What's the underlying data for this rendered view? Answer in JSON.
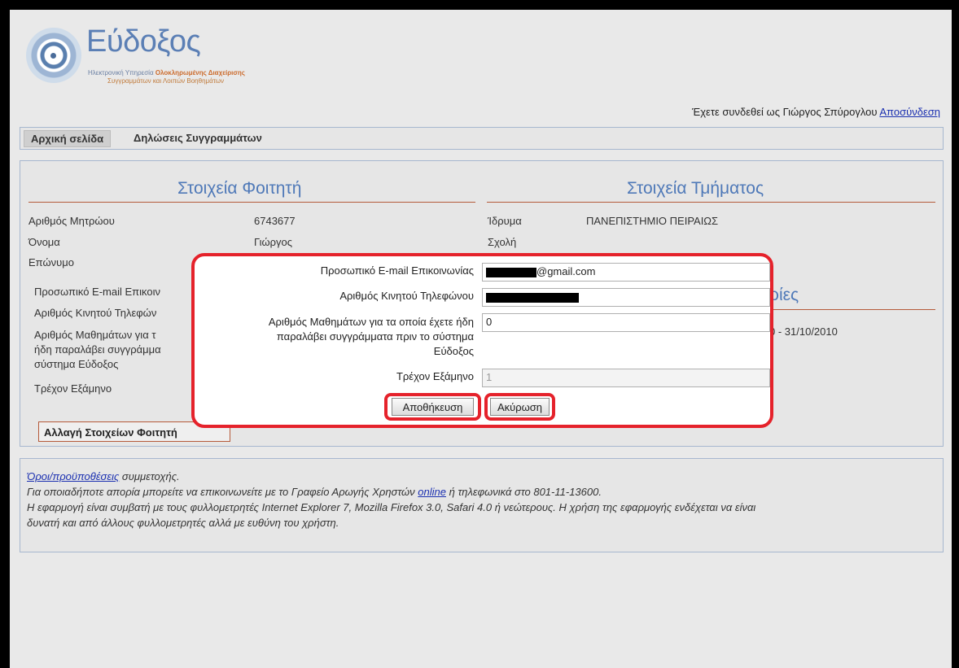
{
  "header": {
    "logo_title": "Εύδοξος",
    "logo_tagline_1": "Ηλεκτρονική Υπηρεσία",
    "logo_tagline_1b": "Ολοκληρωμένης Διαχείρισης",
    "logo_tagline_2": "Συγγραμμάτων και Λοιπών Βοηθημάτων",
    "login_text": "Έχετε συνδεθεί ως Γιώργος Σπύρογλου",
    "logout_link": "Αποσύνδεση"
  },
  "nav": {
    "home": "Αρχική σελίδα",
    "declarations": "Δηλώσεις Συγγραμμάτων"
  },
  "student": {
    "title": "Στοιχεία Φοιτητή",
    "rows": [
      {
        "label": "Αριθμός Μητρώου",
        "value": "6743677"
      },
      {
        "label": "Όνομα",
        "value": "Γιώργος"
      },
      {
        "label": "Επώνυμο",
        "value": ""
      }
    ],
    "partial_rows": [
      "Προσωπικό E-mail Επικοιν",
      "Αριθμός Κινητού Τηλεφών",
      "Αριθμός Μαθημάτων για τ",
      "ήδη παραλάβει συγγράμμα",
      "σύστημα Εύδοξος",
      "Τρέχον Εξάμηνο"
    ],
    "change_button": "Αλλαγή Στοιχείων Φοιτητή"
  },
  "department": {
    "title": "Στοιχεία Τμήματος",
    "rows": [
      {
        "label": "Ίδρυμα",
        "value": "ΠΑΝΕΠΙΣΤΗΜΙΟ ΠΕΙΡΑΙΩΣ"
      },
      {
        "label": "Σχολή",
        "value": ""
      }
    ],
    "partial_title": "ρίες",
    "partial_period": "0 - 31/10/2010"
  },
  "footer": {
    "terms_link": "Όροι/προϋποθέσεις",
    "terms_suffix": " συμμετοχής.",
    "helpdesk_text": "Για οποιαδήποτε απορία μπορείτε να επικοινωνείτε με το Γραφείο Αρωγής Χρηστών ",
    "online_link": "online",
    "helpdesk_suffix": " ή τηλεφωνικά στο 801-11-13600.",
    "compat_line_1": "Η εφαρμογή είναι συμβατή με τους φυλλομετρητές Internet Explorer 7, Mozilla Firefox 3.0, Safari 4.0 ή νεώτερους. Η χρήση της εφαρμογής ενδέχεται να είναι",
    "compat_line_2": "δυνατή και από άλλους φυλλομετρητές αλλά με ευθύνη του χρήστη."
  },
  "modal": {
    "email_label": "Προσωπικό E-mail Επικοινωνίας",
    "email_visible": "@gmail.com",
    "phone_label": "Αριθμός Κινητού Τηλεφώνου",
    "courses_label_1": "Αριθμός Μαθημάτων για τα οποία έχετε ήδη",
    "courses_label_2": "παραλάβει συγγράμματα πριν το σύστημα",
    "courses_label_3": "Εύδοξος",
    "courses_value": "0",
    "semester_label": "Τρέχον Εξάμηνο",
    "semester_value": "1",
    "save_button": "Αποθήκευση",
    "cancel_button": "Ακύρωση"
  },
  "colors": {
    "highlight_red": "#e5222b",
    "section_title_blue": "#4f79b8",
    "link_blue": "#1a2fb0"
  }
}
